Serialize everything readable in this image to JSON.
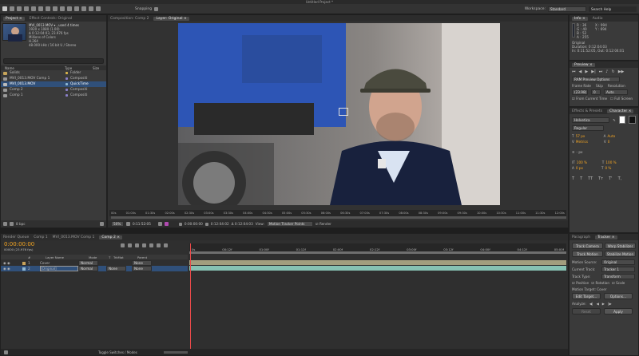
{
  "app": {
    "title": "Untitled Project *"
  },
  "toolbar": {
    "snapping_label": "Snapping",
    "workspace_label": "Workspace:",
    "workspace_value": "Standard",
    "search_placeholder": "Search Help"
  },
  "project_panel": {
    "tabs": [
      "Project ×",
      "Effect Controls: Original"
    ],
    "selected_file": "MVI_0013.MOV ▾ , used 4 times",
    "info_lines": [
      "1920 x 1080 (1.00)",
      "Δ 0:12:04:03, 23.976 fps",
      "Millions of Colors",
      "H.264",
      "48.000 kHz / 16 bit U / Stereo"
    ],
    "columns": [
      "Name",
      "Type",
      "Size"
    ],
    "items": [
      {
        "name": "Solids",
        "type": "Folder"
      },
      {
        "name": "MVI_0013.MOV Comp 1",
        "type": "Compositi"
      },
      {
        "name": "MVI_0013.MOV",
        "type": "QuickTime"
      },
      {
        "name": "Comp 2",
        "type": "Compositi"
      },
      {
        "name": "Comp 1",
        "type": "Compositi"
      }
    ],
    "bpc": "8 bpc"
  },
  "viewer": {
    "tabs": [
      "Composition: Comp 2",
      "Layer: Original ×"
    ],
    "ruler_labels": [
      "00s",
      "01:00s",
      "01:30s",
      "02:00s",
      "02:30s",
      "03:00s",
      "03:30s",
      "04:00s",
      "04:30s",
      "05:00s",
      "05:30s",
      "06:00s",
      "06:30s",
      "07:00s",
      "07:30s",
      "08:00s",
      "08:30s",
      "09:00s",
      "09:30s",
      "10:00s",
      "10:30s",
      "11:00s",
      "11:30s",
      "12:00s"
    ],
    "zoom": "50%",
    "timecode": "0:11:52:05",
    "in_point": "0:00:00:00",
    "out_point": "0:12:04:02",
    "duration": "Δ 0:12:04:03",
    "view_label": "View:",
    "view_value": "Motion Tracker Points",
    "render_label": "Render"
  },
  "info_panel": {
    "tabs": [
      "Info ×",
      "Audio"
    ],
    "r": "R : 36",
    "g": "G : 40",
    "b": "B : 52",
    "a": "A : 255",
    "x": "X : 994",
    "y": "Y : 694",
    "layer": "Original",
    "duration": "Duration: 0:12:04:03",
    "in_out": "In: 0:11:52:05, Out: 0:12:04:01"
  },
  "preview_panel": {
    "title": "Preview ×",
    "ram_preview": "RAM Preview Options",
    "frame_rate_label": "Frame Rate",
    "skip_label": "Skip",
    "resolution_label": "Resolution",
    "frame_rate_value": "(23.98)",
    "skip_value": "0",
    "resolution_value": "Auto",
    "from_current": "From Current Time",
    "full_screen": "Full Screen"
  },
  "character_panel": {
    "tabs": [
      "Effects & Presets",
      "Character ×"
    ],
    "font": "Helvetica",
    "style": "Regular",
    "size": "57 px",
    "leading": "Auto",
    "kerning": "Metrics",
    "tracking": "0",
    "stroke": "- px",
    "vscale": "100 %",
    "hscale": "100 %",
    "baseline": "0 px",
    "tsume": "0 %",
    "format_buttons": [
      "T",
      "T",
      "TT",
      "Tт",
      "T'",
      "T,"
    ]
  },
  "tracker_panel": {
    "tabs": [
      "Paragraph",
      "Tracker ×"
    ],
    "track_camera": "Track Camera",
    "warp_stabilizer": "Warp Stabilizer",
    "track_motion": "Track Motion",
    "stabilize_motion": "Stabilize Motion",
    "motion_source_label": "Motion Source:",
    "motion_source_value": "Original",
    "current_track_label": "Current Track:",
    "current_track_value": "Tracker 1",
    "track_type_label": "Track Type:",
    "track_type_value": "Transform",
    "position": "Position",
    "rotation": "Rotation",
    "scale": "Scale",
    "motion_target": "Motion Target: Cover",
    "edit_target": "Edit Target...",
    "options": "Options...",
    "analyze_label": "Analyze:",
    "reset": "Reset",
    "apply": "Apply"
  },
  "timeline": {
    "tabs": [
      "Render Queue",
      "Comp 1",
      "MVI_0013.MOV Comp 1",
      "Comp 2 ×"
    ],
    "timecode": "0:00:00:00",
    "frame_info": "00000 (23.976 fps)",
    "columns": [
      "#",
      "Layer Name",
      "Mode",
      "T",
      "TrkMat",
      "Parent"
    ],
    "layers": [
      {
        "num": "1",
        "name": "Cover",
        "mode": "Normal",
        "trkmat": "",
        "parent": "None"
      },
      {
        "num": "2",
        "name": "[Original]",
        "mode": "Normal",
        "trkmat": "None",
        "parent": "None"
      }
    ],
    "ruler_labels": [
      "0s",
      "00:12f",
      "01:00f",
      "01:12f",
      "02:00f",
      "02:12f",
      "03:00f",
      "03:12f",
      "04:00f",
      "04:12f",
      "05:00f"
    ],
    "toggle_label": "Toggle Switches / Modes"
  }
}
